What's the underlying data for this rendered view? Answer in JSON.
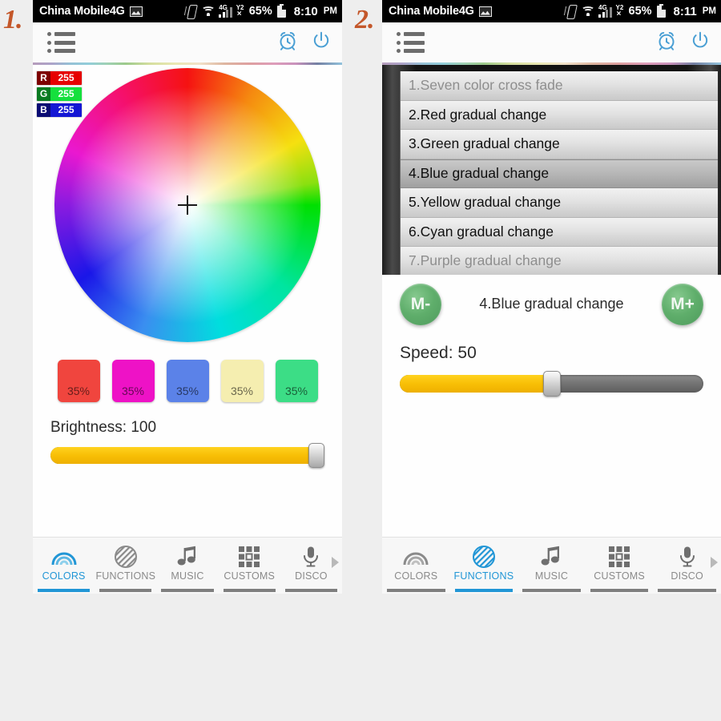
{
  "annotations": {
    "first": "1.",
    "second": "2."
  },
  "statusbar": {
    "carrier": "China Mobile4G",
    "network_label": "4G",
    "sim2_label": "Y2",
    "sim2_none": "×",
    "battery": "65%",
    "time_1": "8:10",
    "time_2": "8:11",
    "ampm": "PM",
    "icons": [
      "picture-icon",
      "vibrate-icon",
      "wifi-icon",
      "signal-icon",
      "sim2-icon",
      "battery-icon"
    ]
  },
  "appbar": {
    "menu_icon": "list-menu-icon",
    "timer_icon": "alarm-clock-icon",
    "power_icon": "power-icon"
  },
  "panel1": {
    "rgb": [
      {
        "channel": "R",
        "value": "255",
        "color": "#e60000"
      },
      {
        "channel": "G",
        "value": "255",
        "color": "#15e03d"
      },
      {
        "channel": "B",
        "value": "255",
        "color": "#1417d4"
      }
    ],
    "color_wheel": {
      "name": "color-wheel",
      "cursor": "crosshair-marker"
    },
    "swatches": [
      {
        "color": "#f0453e",
        "label": "35%"
      },
      {
        "color": "#ee12c6",
        "label": "35%"
      },
      {
        "color": "#5b82e8",
        "label": "35%"
      },
      {
        "color": "#f5eeb0",
        "label": "35%"
      },
      {
        "color": "#3cdd86",
        "label": "35%"
      }
    ],
    "brightness": {
      "label": "Brightness: 100",
      "value": 100,
      "percent": 100
    },
    "active_tab": "COLORS"
  },
  "panel2": {
    "modes": [
      {
        "index": 1,
        "label": "1.Seven color cross fade",
        "state": "partial"
      },
      {
        "index": 2,
        "label": "2.Red gradual change",
        "state": "normal"
      },
      {
        "index": 3,
        "label": "3.Green gradual change",
        "state": "normal"
      },
      {
        "index": 4,
        "label": "4.Blue gradual change",
        "state": "selected"
      },
      {
        "index": 5,
        "label": "5.Yellow gradual change",
        "state": "normal"
      },
      {
        "index": 6,
        "label": "6.Cyan gradual change",
        "state": "normal"
      },
      {
        "index": 7,
        "label": "7.Purple gradual change",
        "state": "partial"
      }
    ],
    "mode_prev_label": "M-",
    "mode_next_label": "M+",
    "current_mode": "4.Blue gradual change",
    "speed": {
      "label": "Speed: 50",
      "value": 50,
      "percent": 50
    },
    "active_tab": "FUNCTIONS"
  },
  "tabs": [
    {
      "label": "COLORS",
      "icon": "rainbow-icon"
    },
    {
      "label": "FUNCTIONS",
      "icon": "striped-circle-icon"
    },
    {
      "label": "MUSIC",
      "icon": "music-note-icon"
    },
    {
      "label": "CUSTOMS",
      "icon": "grid-icon"
    },
    {
      "label": "DISCO",
      "icon": "microphone-icon"
    }
  ],
  "colors": {
    "accent_blue": "#2196d6",
    "slider_yellow": "#f8bf06",
    "button_green": "#5fae6b",
    "annotation": "#c4572a"
  }
}
